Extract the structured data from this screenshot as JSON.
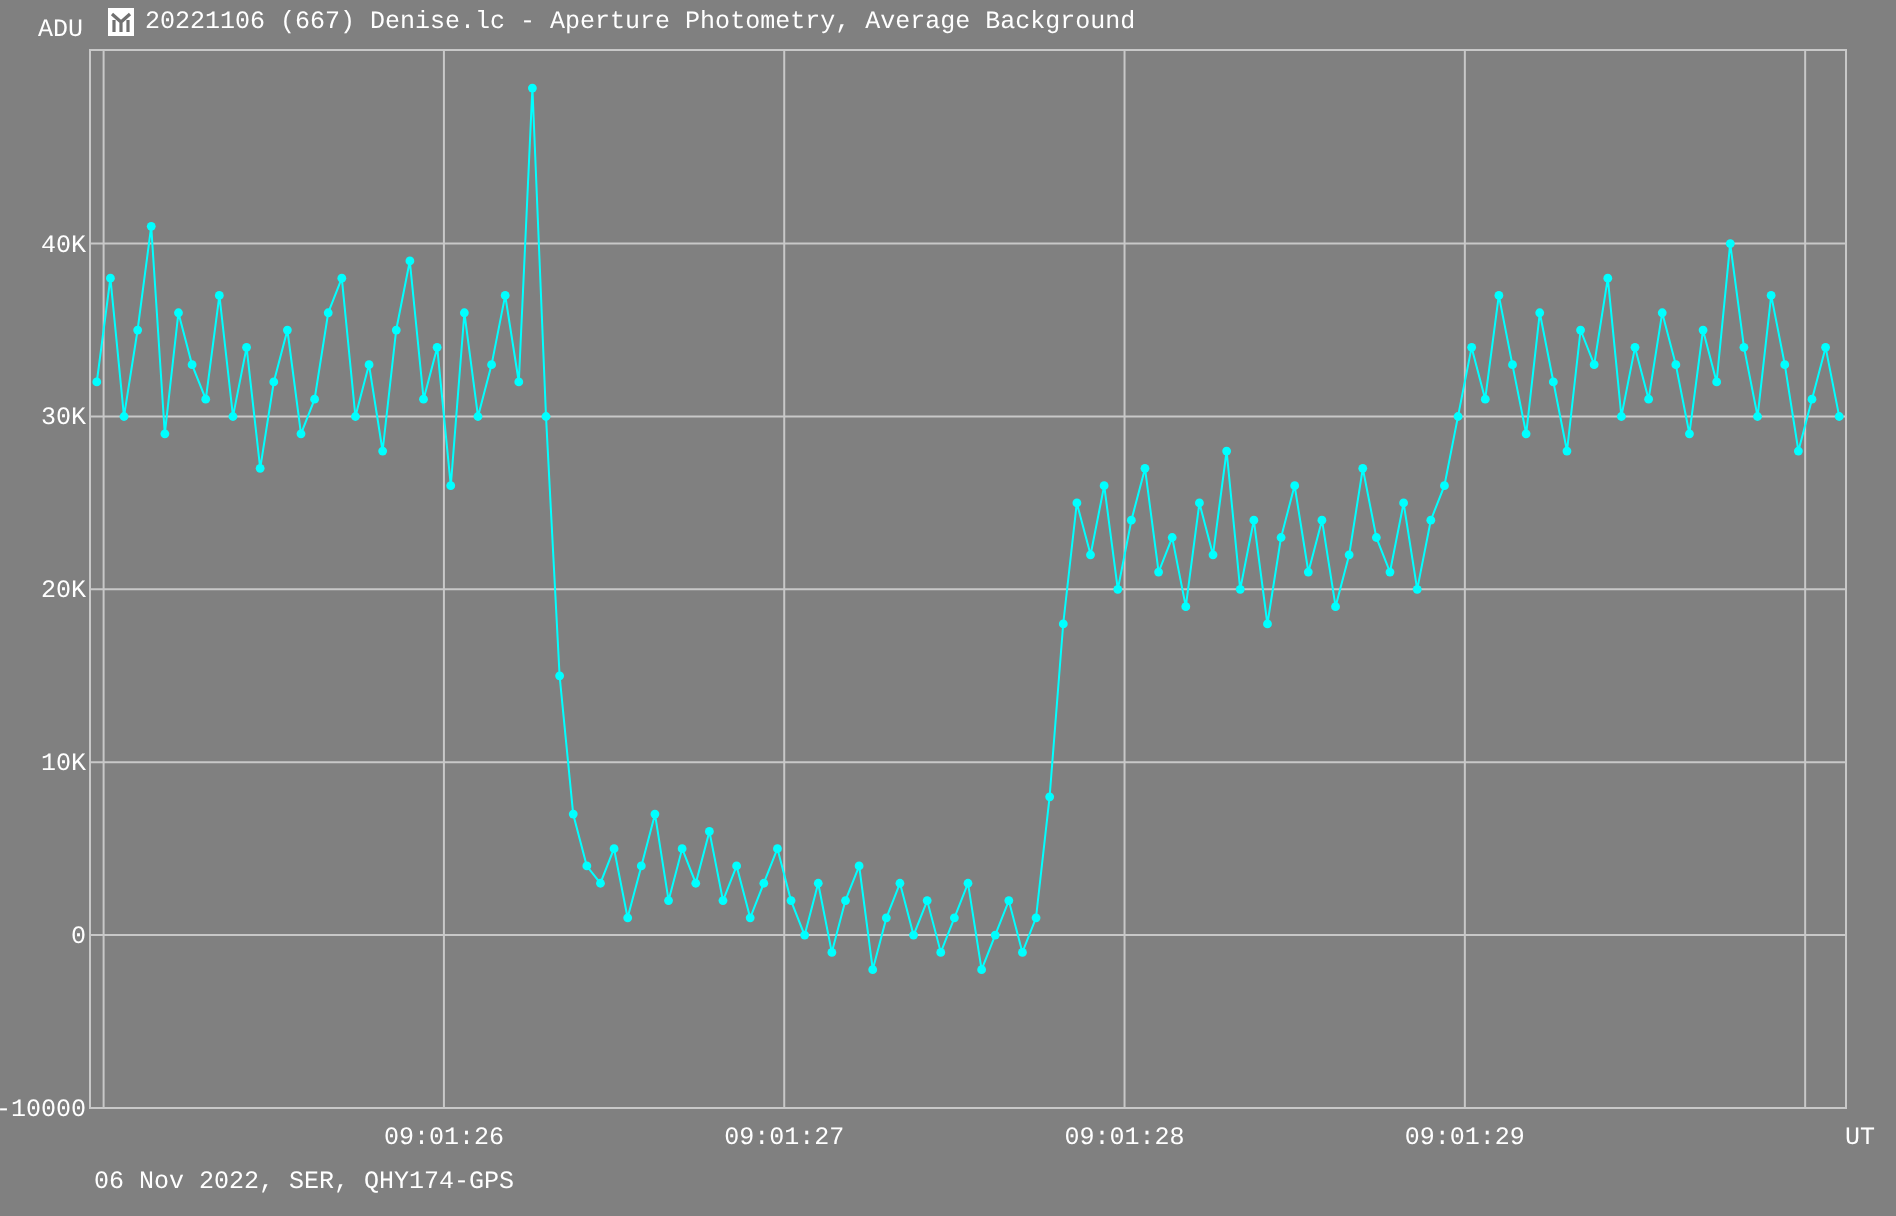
{
  "window": {
    "title": "20221106 (667) Denise.lc - Aperture Photometry, Average Background"
  },
  "chart": {
    "chart_data": {
      "type": "line",
      "xlabel": "UT",
      "ylabel": "ADU",
      "grid": true,
      "xlim": [
        32484.96,
        32490.12
      ],
      "ylim": [
        -10000,
        51200
      ],
      "xticks": [
        {
          "value": 32486,
          "label": "09:01:26"
        },
        {
          "value": 32487,
          "label": "09:01:27"
        },
        {
          "value": 32488,
          "label": "09:01:28"
        },
        {
          "value": 32489,
          "label": "09:01:29"
        }
      ],
      "yticks": [
        {
          "value": -10000,
          "label": "-10000"
        },
        {
          "value": 0,
          "label": "0"
        },
        {
          "value": 10000,
          "label": "10K"
        },
        {
          "value": 20000,
          "label": "20K"
        },
        {
          "value": 30000,
          "label": "30K"
        },
        {
          "value": 40000,
          "label": "40K"
        }
      ],
      "x": [
        32484.98,
        32485.02,
        32485.06,
        32485.1,
        32485.14,
        32485.18,
        32485.22,
        32485.26,
        32485.3,
        32485.34,
        32485.38,
        32485.42,
        32485.46,
        32485.5,
        32485.54,
        32485.58,
        32485.62,
        32485.66,
        32485.7,
        32485.74,
        32485.78,
        32485.82,
        32485.86,
        32485.9,
        32485.94,
        32485.98,
        32486.02,
        32486.06,
        32486.1,
        32486.14,
        32486.18,
        32486.22,
        32486.26,
        32486.3,
        32486.34,
        32486.38,
        32486.42,
        32486.46,
        32486.5,
        32486.54,
        32486.58,
        32486.62,
        32486.66,
        32486.7,
        32486.74,
        32486.78,
        32486.82,
        32486.86,
        32486.9,
        32486.94,
        32486.98,
        32487.02,
        32487.06,
        32487.1,
        32487.14,
        32487.18,
        32487.22,
        32487.26,
        32487.3,
        32487.34,
        32487.38,
        32487.42,
        32487.46,
        32487.5,
        32487.54,
        32487.58,
        32487.62,
        32487.66,
        32487.7,
        32487.74,
        32487.78,
        32487.82,
        32487.86,
        32487.9,
        32487.94,
        32487.98,
        32488.02,
        32488.06,
        32488.1,
        32488.14,
        32488.18,
        32488.22,
        32488.26,
        32488.3,
        32488.34,
        32488.38,
        32488.42,
        32488.46,
        32488.5,
        32488.54,
        32488.58,
        32488.62,
        32488.66,
        32488.7,
        32488.74,
        32488.78,
        32488.82,
        32488.86,
        32488.9,
        32488.94,
        32488.98,
        32489.02,
        32489.06,
        32489.1,
        32489.14,
        32489.18,
        32489.22,
        32489.26,
        32489.3,
        32489.34,
        32489.38,
        32489.42,
        32489.46,
        32489.5,
        32489.54,
        32489.58,
        32489.62,
        32489.66,
        32489.7,
        32489.74,
        32489.78,
        32489.82,
        32489.86,
        32489.9,
        32489.94,
        32489.98,
        32490.02,
        32490.06,
        32490.1
      ],
      "series": [
        {
          "color": "#00ffff",
          "marker": true,
          "values": [
            32000,
            38000,
            30000,
            35000,
            41000,
            29000,
            36000,
            33000,
            31000,
            37000,
            30000,
            34000,
            27000,
            32000,
            35000,
            29000,
            31000,
            36000,
            38000,
            30000,
            33000,
            28000,
            35000,
            39000,
            31000,
            34000,
            26000,
            36000,
            30000,
            33000,
            37000,
            32000,
            49000,
            30000,
            15000,
            7000,
            4000,
            3000,
            5000,
            1000,
            4000,
            7000,
            2000,
            5000,
            3000,
            6000,
            2000,
            4000,
            1000,
            3000,
            5000,
            2000,
            0,
            3000,
            -1000,
            2000,
            4000,
            -2000,
            1000,
            3000,
            0,
            2000,
            -1000,
            1000,
            3000,
            -2000,
            0,
            2000,
            -1000,
            1000,
            8000,
            18000,
            25000,
            22000,
            26000,
            20000,
            24000,
            27000,
            21000,
            23000,
            19000,
            25000,
            22000,
            28000,
            20000,
            24000,
            18000,
            23000,
            26000,
            21000,
            24000,
            19000,
            22000,
            27000,
            23000,
            21000,
            25000,
            20000,
            24000,
            26000,
            30000,
            34000,
            31000,
            37000,
            33000,
            29000,
            36000,
            32000,
            28000,
            35000,
            33000,
            38000,
            30000,
            34000,
            31000,
            36000,
            33000,
            29000,
            35000,
            32000,
            40000,
            34000,
            30000,
            37000,
            33000,
            28000,
            31000,
            34000,
            30000
          ]
        }
      ]
    }
  },
  "footer": "06 Nov 2022, SER, QHY174-GPS"
}
